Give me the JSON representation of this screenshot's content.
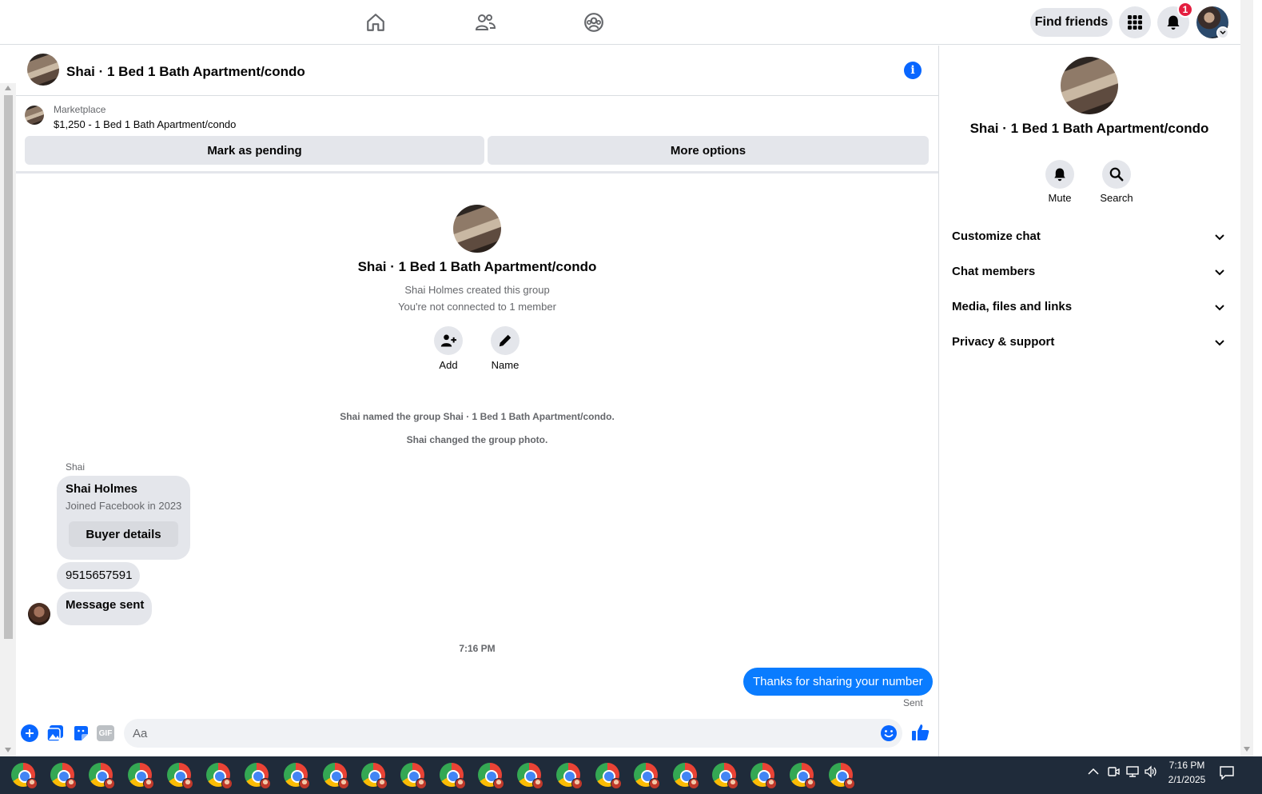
{
  "topbar": {
    "find_friends": "Find friends",
    "notification_count": "1"
  },
  "conversation": {
    "title": "Shai · 1 Bed 1 Bath Apartment/condo",
    "marketplace_label": "Marketplace",
    "listing": "$1,250 - 1 Bed 1 Bath Apartment/condo",
    "mark_pending": "Mark as pending",
    "more_options": "More options"
  },
  "intro": {
    "group_name": "Shai · 1 Bed 1 Bath Apartment/condo",
    "created_by": "Shai Holmes created this group",
    "not_connected": "You're not connected to 1 member",
    "add_label": "Add",
    "name_label": "Name",
    "sys_named": "Shai named the group Shai · 1 Bed 1 Bath Apartment/condo.",
    "sys_photo": "Shai changed the group photo."
  },
  "messages": {
    "sender_name": "Shai",
    "card_name": "Shai Holmes",
    "card_joined": "Joined Facebook in 2023",
    "buyer_details": "Buyer details",
    "phone": "9515657591",
    "message_sent": "Message sent",
    "timestamp": "7:16 PM",
    "outgoing": "Thanks for sharing your number",
    "status": "Sent"
  },
  "composer": {
    "placeholder": "Aa"
  },
  "right_panel": {
    "title": "Shai · 1 Bed 1 Bath Apartment/condo",
    "mute": "Mute",
    "search": "Search",
    "sections": [
      "Customize chat",
      "Chat members",
      "Media, files and links",
      "Privacy & support"
    ]
  },
  "taskbar": {
    "time": "7:16 PM",
    "date": "2/1/2025"
  },
  "colors": {
    "accent": "#0866ff",
    "outgoing_bubble": "#0a7cff",
    "badge": "#e41e3f",
    "taskbar": "#1f2b3a"
  }
}
